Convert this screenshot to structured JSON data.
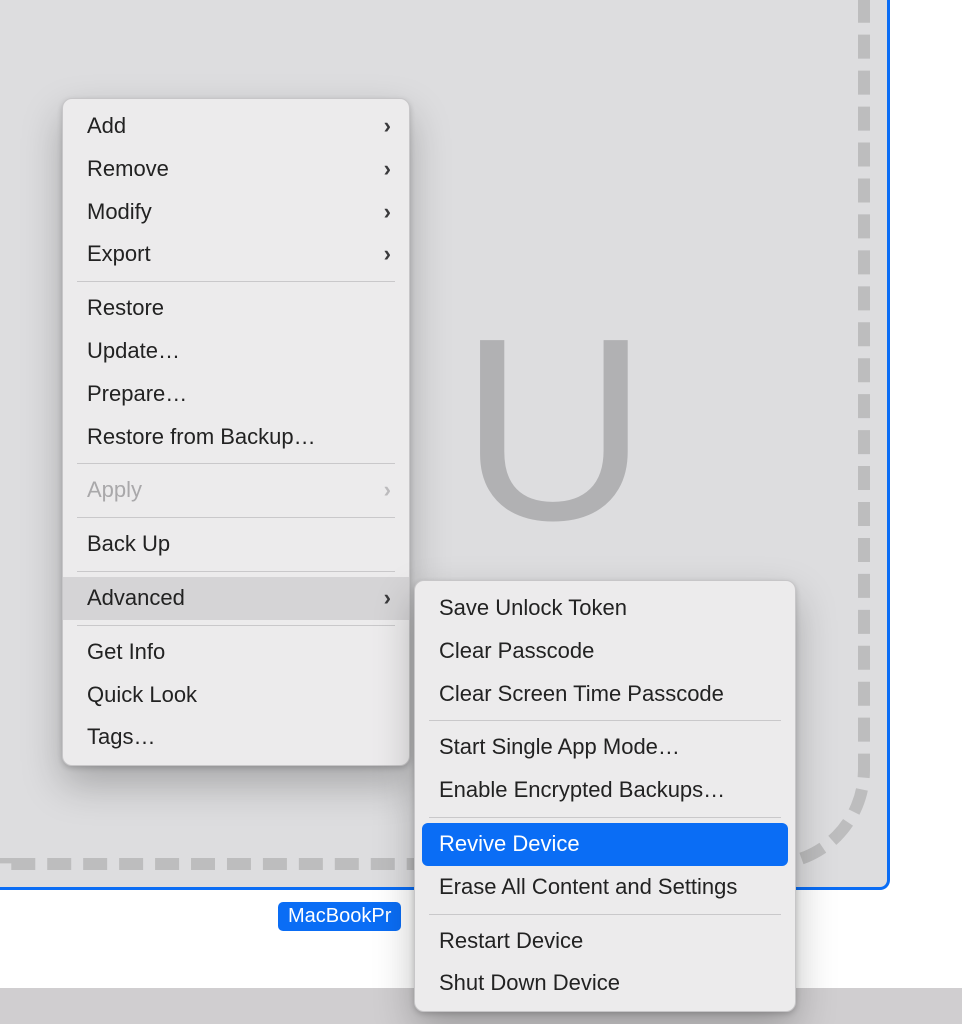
{
  "device": {
    "label": "MacBookPr",
    "glyph": "U"
  },
  "main_menu": {
    "items": [
      {
        "label": "Add",
        "submenu": true
      },
      {
        "label": "Remove",
        "submenu": true
      },
      {
        "label": "Modify",
        "submenu": true
      },
      {
        "label": "Export",
        "submenu": true
      }
    ],
    "group2": [
      {
        "label": "Restore"
      },
      {
        "label": "Update…"
      },
      {
        "label": "Prepare…"
      },
      {
        "label": "Restore from Backup…"
      }
    ],
    "apply": {
      "label": "Apply",
      "submenu": true,
      "disabled": true
    },
    "backup": {
      "label": "Back Up"
    },
    "advanced": {
      "label": "Advanced",
      "submenu": true,
      "highlighted": true
    },
    "group3": [
      {
        "label": "Get Info"
      },
      {
        "label": "Quick Look"
      },
      {
        "label": "Tags…"
      }
    ]
  },
  "advanced_submenu": {
    "group1": [
      {
        "label": "Save Unlock Token"
      },
      {
        "label": "Clear Passcode"
      },
      {
        "label": "Clear Screen Time Passcode"
      }
    ],
    "group2": [
      {
        "label": "Start Single App Mode…"
      },
      {
        "label": "Enable Encrypted Backups…"
      }
    ],
    "group3": [
      {
        "label": "Revive Device",
        "highlighted": true
      },
      {
        "label": "Erase All Content and Settings"
      }
    ],
    "group4": [
      {
        "label": "Restart Device"
      },
      {
        "label": "Shut Down Device"
      }
    ]
  }
}
